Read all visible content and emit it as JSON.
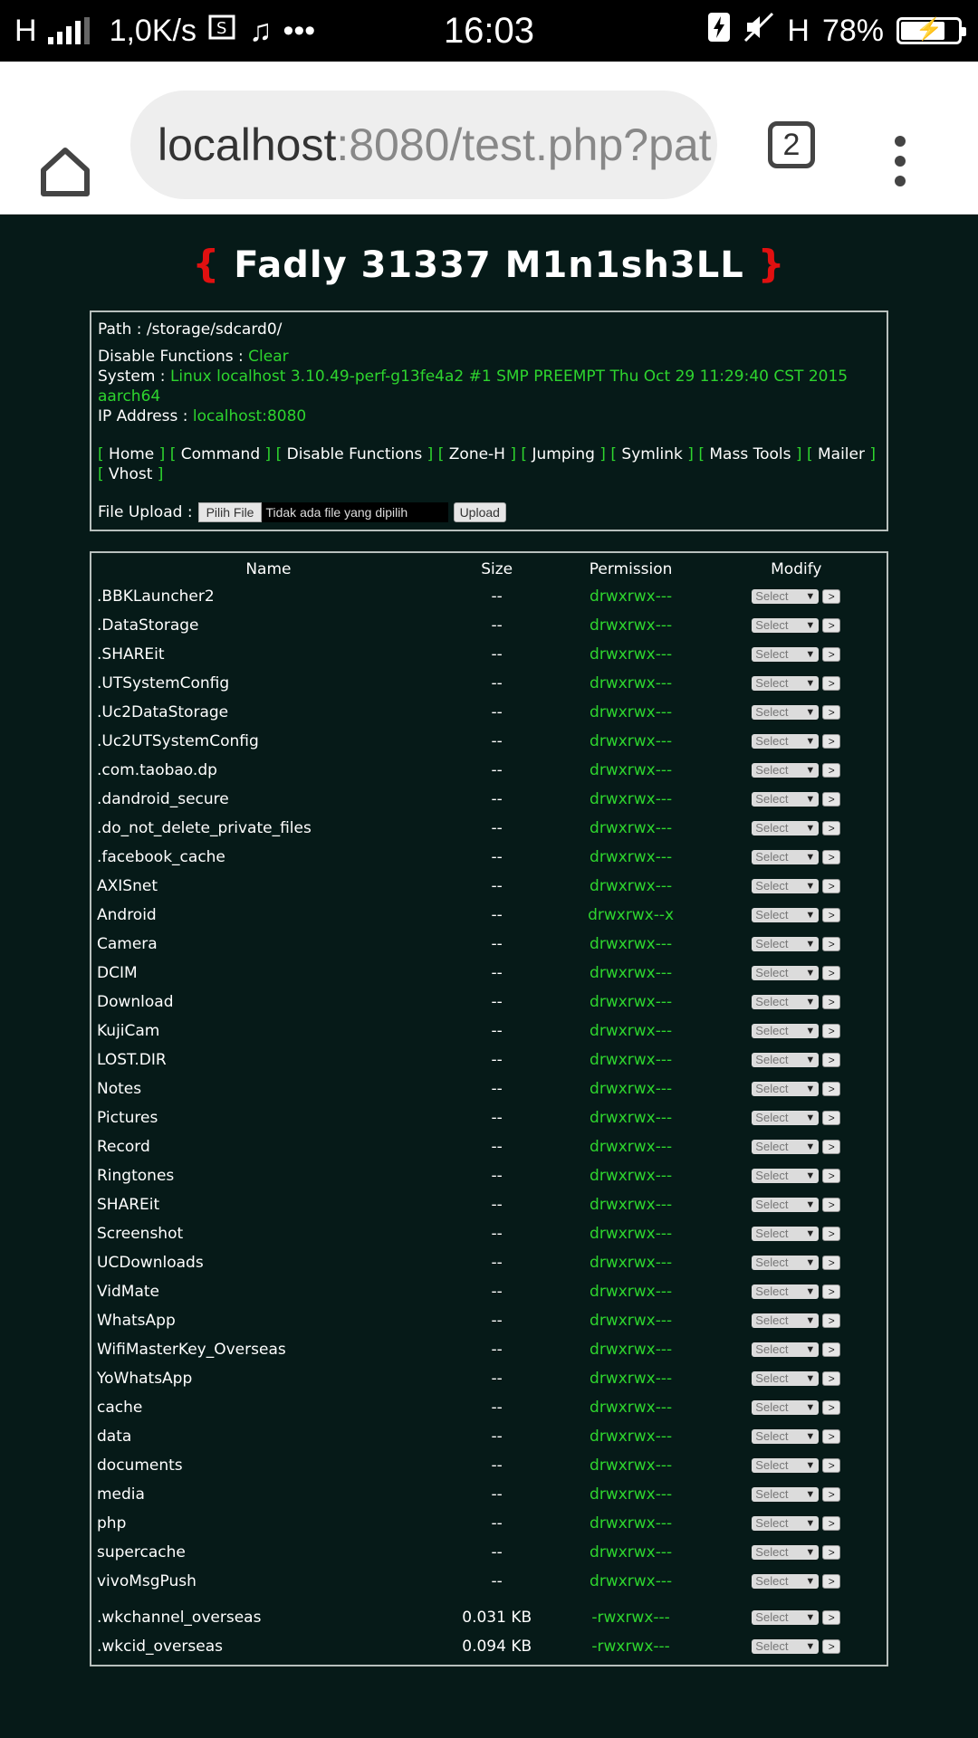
{
  "status_bar": {
    "network": "H",
    "speed": "1,0K/s",
    "time": "16:03",
    "network_type": "H",
    "battery_percent": "78%",
    "battery_level": 0.78
  },
  "browser": {
    "url_host": "localhost",
    "url_rest": ":8080/test.php?pat",
    "tab_count": "2"
  },
  "title": {
    "open_brace": "{",
    "text": "Fadly 31337 M1n1sh3LL",
    "close_brace": "}"
  },
  "info": {
    "path_label": "Path : ",
    "path_value": "/storage/sdcard0/",
    "disable_functions_label": "Disable Functions : ",
    "disable_functions_value": "Clear",
    "system_label": "System : ",
    "system_value": "Linux localhost 3.10.49-perf-g13fe4a2 #1 SMP PREEMPT Thu Oct 29 11:29:40 CST 2015 aarch64",
    "ip_label": "IP Address : ",
    "ip_value": "localhost:8080"
  },
  "nav": [
    "Home",
    "Command",
    "Disable Functions",
    "Zone-H",
    "Jumping",
    "Symlink",
    "Mass Tools",
    "Mailer",
    "Vhost"
  ],
  "upload": {
    "label": "File Upload :",
    "pick_label": "Pilih File",
    "no_file_text": "Tidak ada file yang dipilih",
    "upload_label": "Upload"
  },
  "table": {
    "headers": [
      "Name",
      "Size",
      "Permission",
      "Modify"
    ],
    "select_label": "Select",
    "go_label": ">",
    "dirs": [
      {
        "name": ".BBKLauncher2",
        "size": "--",
        "perm": "drwxrwx---"
      },
      {
        "name": ".DataStorage",
        "size": "--",
        "perm": "drwxrwx---"
      },
      {
        "name": ".SHAREit",
        "size": "--",
        "perm": "drwxrwx---"
      },
      {
        "name": ".UTSystemConfig",
        "size": "--",
        "perm": "drwxrwx---"
      },
      {
        "name": ".Uc2DataStorage",
        "size": "--",
        "perm": "drwxrwx---"
      },
      {
        "name": ".Uc2UTSystemConfig",
        "size": "--",
        "perm": "drwxrwx---"
      },
      {
        "name": ".com.taobao.dp",
        "size": "--",
        "perm": "drwxrwx---"
      },
      {
        "name": ".dandroid_secure",
        "size": "--",
        "perm": "drwxrwx---"
      },
      {
        "name": ".do_not_delete_private_files",
        "size": "--",
        "perm": "drwxrwx---"
      },
      {
        "name": ".facebook_cache",
        "size": "--",
        "perm": "drwxrwx---"
      },
      {
        "name": "AXISnet",
        "size": "--",
        "perm": "drwxrwx---"
      },
      {
        "name": "Android",
        "size": "--",
        "perm": "drwxrwx--x"
      },
      {
        "name": "Camera",
        "size": "--",
        "perm": "drwxrwx---"
      },
      {
        "name": "DCIM",
        "size": "--",
        "perm": "drwxrwx---"
      },
      {
        "name": "Download",
        "size": "--",
        "perm": "drwxrwx---"
      },
      {
        "name": "KujiCam",
        "size": "--",
        "perm": "drwxrwx---"
      },
      {
        "name": "LOST.DIR",
        "size": "--",
        "perm": "drwxrwx---"
      },
      {
        "name": "Notes",
        "size": "--",
        "perm": "drwxrwx---"
      },
      {
        "name": "Pictures",
        "size": "--",
        "perm": "drwxrwx---"
      },
      {
        "name": "Record",
        "size": "--",
        "perm": "drwxrwx---"
      },
      {
        "name": "Ringtones",
        "size": "--",
        "perm": "drwxrwx---"
      },
      {
        "name": "SHAREit",
        "size": "--",
        "perm": "drwxrwx---"
      },
      {
        "name": "Screenshot",
        "size": "--",
        "perm": "drwxrwx---"
      },
      {
        "name": "UCDownloads",
        "size": "--",
        "perm": "drwxrwx---"
      },
      {
        "name": "VidMate",
        "size": "--",
        "perm": "drwxrwx---"
      },
      {
        "name": "WhatsApp",
        "size": "--",
        "perm": "drwxrwx---"
      },
      {
        "name": "WifiMasterKey_Overseas",
        "size": "--",
        "perm": "drwxrwx---"
      },
      {
        "name": "YoWhatsApp",
        "size": "--",
        "perm": "drwxrwx---"
      },
      {
        "name": "cache",
        "size": "--",
        "perm": "drwxrwx---"
      },
      {
        "name": "data",
        "size": "--",
        "perm": "drwxrwx---"
      },
      {
        "name": "documents",
        "size": "--",
        "perm": "drwxrwx---"
      },
      {
        "name": "media",
        "size": "--",
        "perm": "drwxrwx---"
      },
      {
        "name": "php",
        "size": "--",
        "perm": "drwxrwx---"
      },
      {
        "name": "supercache",
        "size": "--",
        "perm": "drwxrwx---"
      },
      {
        "name": "vivoMsgPush",
        "size": "--",
        "perm": "drwxrwx---"
      }
    ],
    "files": [
      {
        "name": ".wkchannel_overseas",
        "size": "0.031 KB",
        "perm": "-rwxrwx---"
      },
      {
        "name": ".wkcid_overseas",
        "size": "0.094 KB",
        "perm": "-rwxrwx---"
      }
    ]
  }
}
